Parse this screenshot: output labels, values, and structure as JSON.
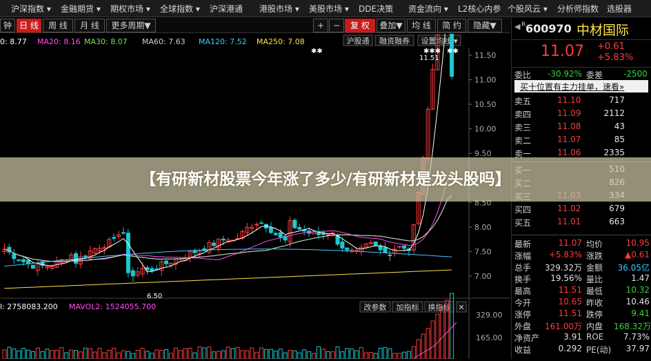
{
  "menu": {
    "items": [
      "沪深指数 ▾",
      "金融期货 ▾",
      "期权市场 ▾",
      "全球指数 ▾",
      "沪深港通",
      "港股市场 ▾",
      "美股市场 ▾",
      "DDE决策",
      "资金流向 ▾",
      "L2核心内参",
      "个股风云 ▾",
      "分析师指数",
      "选股器"
    ]
  },
  "toolbar": {
    "left": [
      "钟",
      "日 线",
      "周 线",
      "月 线",
      "更多周期▼"
    ],
    "right": [
      "+",
      "−",
      "复 权",
      "叠加▼",
      "均 线",
      "简 约",
      "隐藏▼"
    ],
    "sub": [
      "沪股通",
      "融资融券",
      "设置均线 ▾"
    ]
  },
  "ma_legend": [
    {
      "text": "0: 8.77",
      "color": "#ffffff"
    },
    {
      "text": "MA20: 8.16",
      "color": "#ff4df0"
    },
    {
      "text": "MA30: 8.07",
      "color": "#7ee060"
    },
    {
      "text": "MA60: 7.63",
      "color": "#d0d0d0"
    },
    {
      "text": "MA120: 7.52",
      "color": "#40c8ff"
    },
    {
      "text": "MA250: 7.08",
      "color": "#ffe24a"
    }
  ],
  "price_axis": [
    "11.50",
    "11.00",
    "10.50",
    "10.00",
    "9.50",
    "9.00",
    "8.50",
    "8.00",
    "7.50",
    "7.00"
  ],
  "annotations": {
    "high": "11.51",
    "low": "6.50",
    "stars": "✱✱",
    "stars3": "✱✱✱"
  },
  "vol_legend": [
    {
      "text": "l: 2758083.200",
      "color": "#ffffff"
    },
    {
      "text": "MAVOL2: 1524055.700",
      "color": "#ff4df0"
    }
  ],
  "vol_buttons": [
    "改参数",
    "加指标",
    "换指标",
    "✕"
  ],
  "vol_axis": [
    "329.00",
    "165.00"
  ],
  "side": {
    "code": "600970",
    "name": "中材国际",
    "price": "11.07",
    "change": "+0.61",
    "change_pct": "+5.83%",
    "webi_label": "委比",
    "webi": "-30.92%",
    "weicha_label": "委差",
    "weicha": "-2500",
    "link": "买十位置有主力挂单，速看»",
    "sells": [
      {
        "label": "卖五",
        "price": "11.10",
        "vol": "717"
      },
      {
        "label": "卖四",
        "price": "11.09",
        "vol": "2112"
      },
      {
        "label": "卖三",
        "price": "11.08",
        "vol": "43"
      },
      {
        "label": "卖二",
        "price": "11.07",
        "vol": "85"
      },
      {
        "label": "卖一",
        "price": "11.06",
        "vol": "2335"
      }
    ],
    "buys": [
      {
        "label": "买一",
        "price": "",
        "vol": "510"
      },
      {
        "label": "买二",
        "price": "",
        "vol": "826"
      },
      {
        "label": "买三",
        "price": "11.03",
        "vol": "334"
      },
      {
        "label": "买四",
        "price": "11.02",
        "vol": "679"
      },
      {
        "label": "买五",
        "price": "11.01",
        "vol": "663"
      }
    ],
    "stats": [
      {
        "l1": "最新",
        "v1": "11.07",
        "c1": "#ff3b3b",
        "l2": "均价",
        "v2": "10.95",
        "c2": "#ff3b3b"
      },
      {
        "l1": "涨幅",
        "v1": "+5.83%",
        "c1": "#ff3b3b",
        "l2": "涨跌",
        "v2": "▲0.61",
        "c2": "#ff3b3b"
      },
      {
        "l1": "总手",
        "v1": "329.32万",
        "c1": "#e0e0e0",
        "l2": "金额",
        "v2": "36.05亿",
        "c2": "#40c8ff"
      },
      {
        "l1": "换手",
        "v1": "19.56%",
        "c1": "#e0e0e0",
        "l2": "量比",
        "v2": "1.47",
        "c2": "#e0e0e0"
      },
      {
        "l1": "最高",
        "v1": "11.51",
        "c1": "#ff3b3b",
        "l2": "最低",
        "v2": "10.32",
        "c2": "#3bd13b"
      },
      {
        "l1": "今开",
        "v1": "10.65",
        "c1": "#ff3b3b",
        "l2": "昨收",
        "v2": "10.46",
        "c2": "#e0e0e0"
      },
      {
        "l1": "涨停",
        "v1": "11.51",
        "c1": "#ff3b3b",
        "l2": "跌停",
        "v2": "9.41",
        "c2": "#3bd13b"
      },
      {
        "l1": "外盘",
        "v1": "161.00万",
        "c1": "#ff3b3b",
        "l2": "内盘",
        "v2": "168.32万",
        "c2": "#3bd13b"
      },
      {
        "l1": "净资产",
        "v1": "3.91",
        "c1": "#e0e0e0",
        "l2": "ROE",
        "v2": "7.73%",
        "c2": "#e0e0e0"
      },
      {
        "l1": "收益",
        "v1": "0.292",
        "c1": "#e0e0e0",
        "l2": "PE(动)",
        "v2": "37.97",
        "c2": "#e0e0e0"
      }
    ]
  },
  "banner": {
    "title": "【有研新材股票今年涨了多少/有研新材是龙头股吗】"
  },
  "colors": {
    "up": "#ff3b3b",
    "down": "#1ec8d0",
    "bg": "#000000"
  }
}
